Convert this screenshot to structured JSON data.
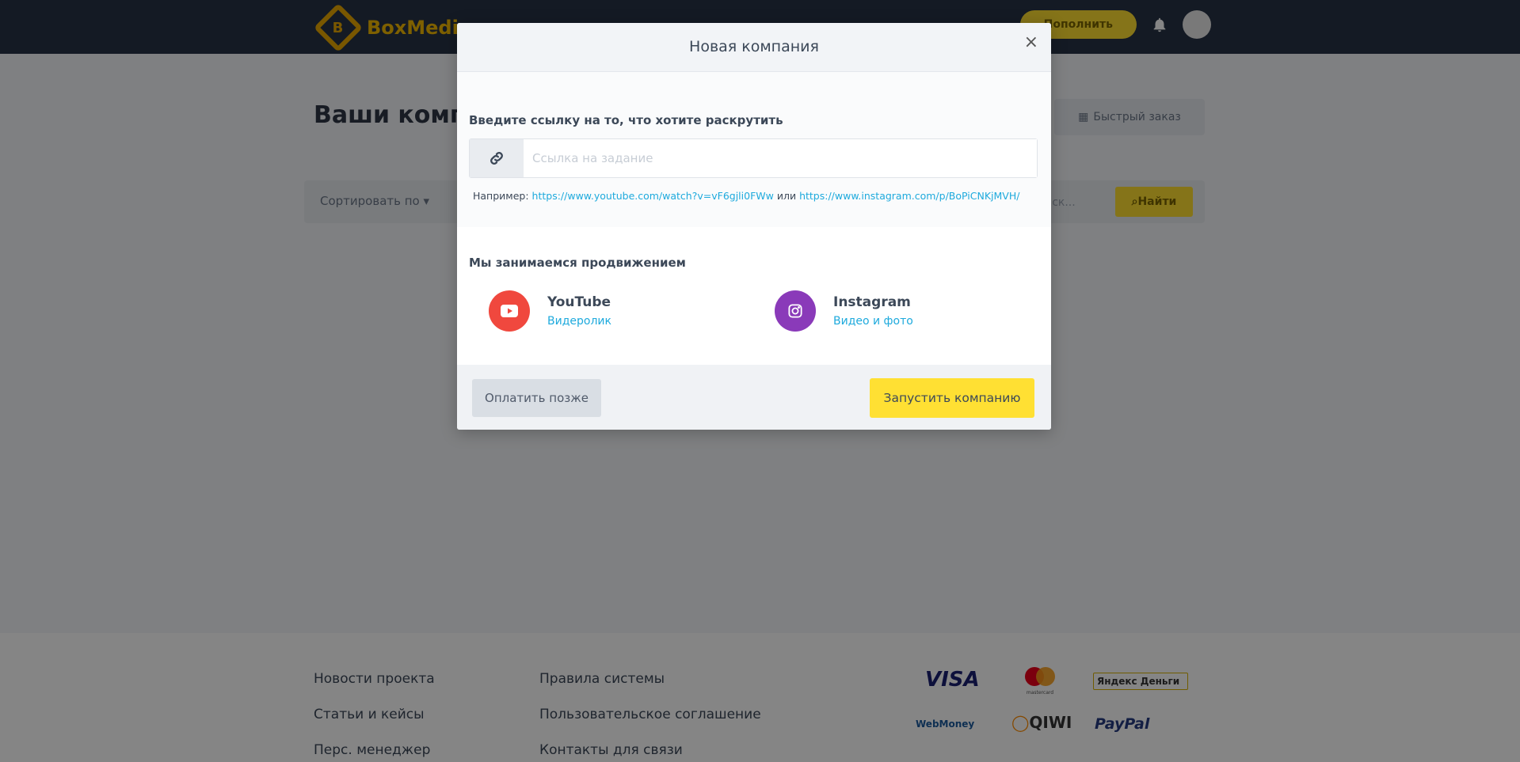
{
  "background": {
    "logo_text": "BoxMedia",
    "balance_button": "Пополнить",
    "page_title": "Ваши компании",
    "quick_order": "Быстрый заказ",
    "sort_label": "Сортировать по",
    "search_placeholder": "Поиск...",
    "find_button": "Найти",
    "footer": {
      "col1": [
        "Новости проекта",
        "Статьи и кейсы",
        "Перс. менеджер"
      ],
      "col2": [
        "Правила системы",
        "Пользовательское соглашение",
        "Контакты для связи"
      ],
      "payments": [
        "VISA",
        "mastercard",
        "Яндекс Деньги",
        "WebMoney",
        "QIWI",
        "PayPal"
      ]
    }
  },
  "modal": {
    "title": "Новая компания",
    "close_label": "×",
    "link_section": {
      "label": "Введите ссылку на то, что хотите раскрутить",
      "input_placeholder": "Ссылка на задание",
      "input_value": "",
      "example_prefix": "Например:",
      "example_link1": "https://www.youtube.com/watch?v=vF6gjli0FWw",
      "example_or": "или",
      "example_link2": "https://www.instagram.com/p/BoPiCNKjMVH/"
    },
    "services_section": {
      "label": "Мы занимаемся продвижением",
      "services": [
        {
          "name": "YouTube",
          "sub": "Видеролик",
          "icon": "youtube-icon",
          "color": "#f0483e"
        },
        {
          "name": "Instagram",
          "sub": "Видео и фото",
          "icon": "instagram-icon",
          "color": "#8a3ab9"
        }
      ]
    },
    "footer": {
      "pay_later": "Оплатить позже",
      "launch": "Запустить компанию"
    }
  },
  "colors": {
    "accent_yellow": "#ffe033",
    "link_blue": "#1eaadd",
    "header_dark": "#283346"
  }
}
